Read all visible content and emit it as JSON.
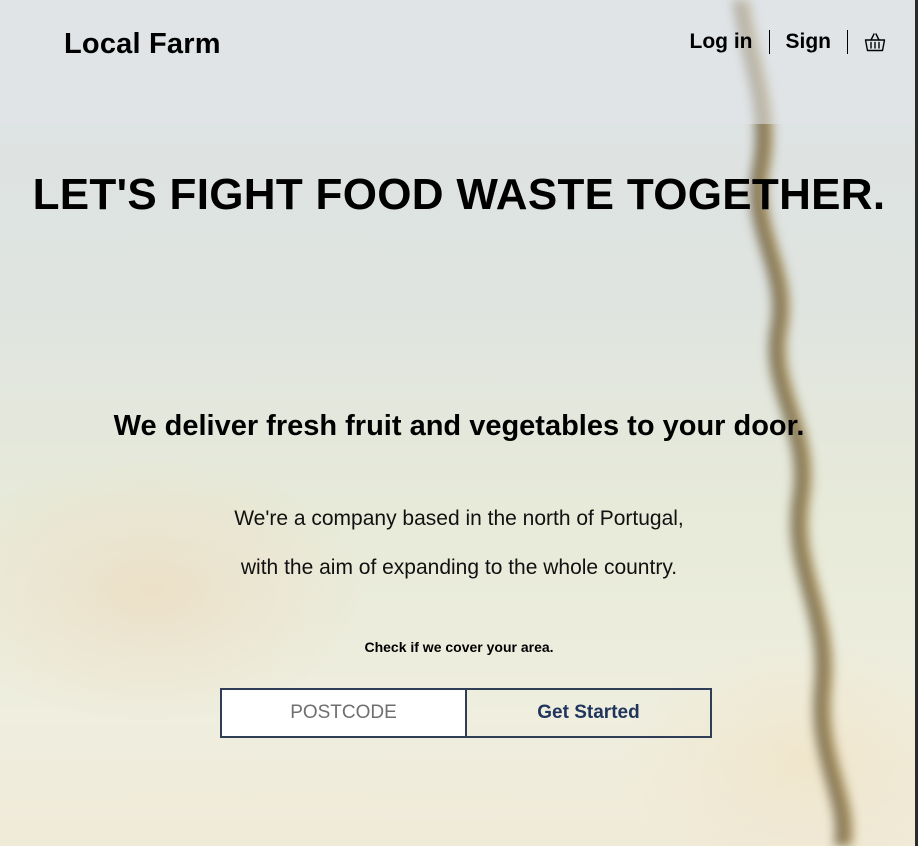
{
  "header": {
    "logo": "Local Farm",
    "nav": {
      "login_label": "Log in",
      "sign_label": "Sign"
    },
    "icons": {
      "basket": "shopping-basket-icon"
    }
  },
  "hero": {
    "headline": "LET'S FIGHT FOOD WASTE TOGETHER.",
    "subheadline": "We deliver fresh fruit and vegetables to your door.",
    "description_line1": "We're a company based in the north of Portugal,",
    "description_line2": "with the aim of expanding to the whole country.",
    "check_text": "Check if we cover your area."
  },
  "form": {
    "postcode_placeholder": "POSTCODE",
    "postcode_value": "",
    "submit_label": "Get Started"
  },
  "colors": {
    "accent": "#1f355c",
    "border": "#2f3e56",
    "text": "#000000"
  }
}
